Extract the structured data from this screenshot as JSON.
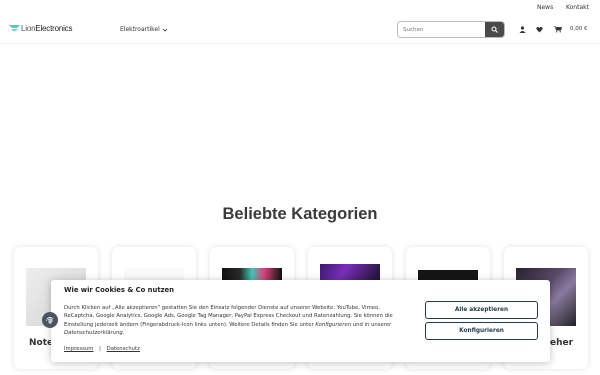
{
  "topbar": {
    "news": "News",
    "contact": "Kontakt"
  },
  "header": {
    "logo_part1": "Lion",
    "logo_part2": "Electronics",
    "menu_label": "Elektroartikel",
    "search_placeholder": "Suchen",
    "cart_price": "0,00 €"
  },
  "icons": {
    "search": "search-icon",
    "user": "user-icon",
    "wishlist": "heart-icon",
    "cart": "cart-icon",
    "fingerprint": "fingerprint-icon"
  },
  "colors": {
    "accent": "#1f3a4d",
    "logo_accent": "#4ecdc4"
  },
  "main": {
    "section_title": "Beliebte Kategorien",
    "categories": [
      {
        "label": "Note"
      },
      {
        "label": ""
      },
      {
        "label": ""
      },
      {
        "label": ""
      },
      {
        "label": ""
      },
      {
        "label": "eher"
      }
    ]
  },
  "cookie": {
    "title": "Wie wir Cookies & Co nutzen",
    "text_1": "Durch Klicken auf „Alle akzeptieren\" gestatten Sie den Einsatz folgender Dienste auf unserer Website: YouTube, Vimeo, ReCaptcha, Google Analytics, Google Ads, Google Tag Manager, PayPal Express Checkout und Ratenzahlung. Sie können die Einstellung jederzeit ändern (Fingerabdruck-Icon links unten). Weitere Details finden Sie unter ",
    "text_link1": "Konfigurieren",
    "text_2": " und in unserer ",
    "text_link2": "Datenschutzerklärung",
    "text_3": ".",
    "link_impressum": "Impressum",
    "link_separator": "|",
    "link_datenschutz": "Datenschutz",
    "accept_all": "Alle akzeptieren",
    "configure": "Konfigurieren"
  }
}
